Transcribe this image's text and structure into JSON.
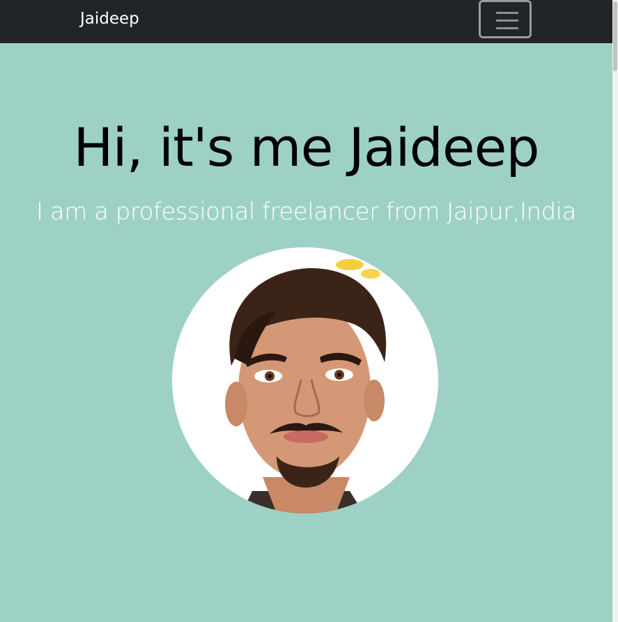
{
  "navbar": {
    "brand": "Jaideep",
    "toggler_icon": "hamburger-menu-icon",
    "background": "#212529"
  },
  "hero": {
    "title": "Hi, it's me Jaideep",
    "subtitle": "I am a professional freelancer from Jaipur,India",
    "background": "#9ed1c5",
    "avatar_image": "profile-portrait"
  }
}
